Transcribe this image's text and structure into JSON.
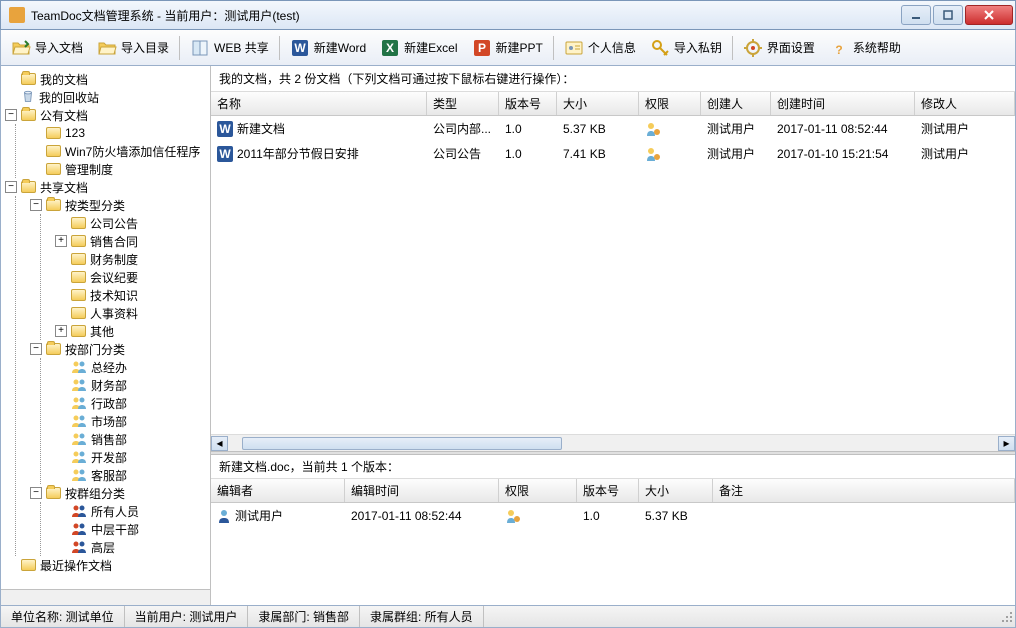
{
  "window": {
    "title": "TeamDoc文档管理系统 - 当前用户：测试用户(test)"
  },
  "toolbar": {
    "import_doc": "导入文档",
    "import_dir": "导入目录",
    "web_share": "WEB 共享",
    "new_word": "新建Word",
    "new_excel": "新建Excel",
    "new_ppt": "新建PPT",
    "personal_info": "个人信息",
    "import_key": "导入私钥",
    "ui_settings": "界面设置",
    "help": "系统帮助"
  },
  "tree": {
    "my_docs": "我的文档",
    "recycle": "我的回收站",
    "public_docs": "公有文档",
    "public_children": {
      "c1": "123",
      "c2": "Win7防火墙添加信任程序",
      "c3": "管理制度"
    },
    "shared_docs": "共享文档",
    "by_type": "按类型分类",
    "type_children": {
      "t1": "公司公告",
      "t2": "销售合同",
      "t3": "财务制度",
      "t4": "会议纪要",
      "t5": "技术知识",
      "t6": "人事资料",
      "t7": "其他"
    },
    "by_dept": "按部门分类",
    "dept_children": {
      "d1": "总经办",
      "d2": "财务部",
      "d3": "行政部",
      "d4": "市场部",
      "d5": "销售部",
      "d6": "开发部",
      "d7": "客服部"
    },
    "by_group": "按群组分类",
    "group_children": {
      "g1": "所有人员",
      "g2": "中层干部",
      "g3": "高层"
    },
    "recent": "最近操作文档"
  },
  "main": {
    "info_text": "我的文档，共 2 份文档（下列文档可通过按下鼠标右键进行操作）：",
    "columns": {
      "name": "名称",
      "type": "类型",
      "version": "版本号",
      "size": "大小",
      "perm": "权限",
      "creator": "创建人",
      "ctime": "创建时间",
      "modifier": "修改人"
    },
    "rows": [
      {
        "name": "新建文档",
        "type": "公司内部...",
        "version": "1.0",
        "size": "5.37 KB",
        "creator": "测试用户",
        "ctime": "2017-01-11 08:52:44",
        "modifier": "测试用户"
      },
      {
        "name": "2011年部分节假日安排",
        "type": "公司公告",
        "version": "1.0",
        "size": "7.41 KB",
        "creator": "测试用户",
        "ctime": "2017-01-10 15:21:54",
        "modifier": "测试用户"
      }
    ]
  },
  "version_panel": {
    "info_text": "新建文档.doc，当前共 1 个版本：",
    "columns": {
      "editor": "编辑者",
      "etime": "编辑时间",
      "perm": "权限",
      "version": "版本号",
      "size": "大小",
      "note": "备注"
    },
    "rows": [
      {
        "editor": "测试用户",
        "etime": "2017-01-11 08:52:44",
        "version": "1.0",
        "size": "5.37 KB",
        "note": ""
      }
    ]
  },
  "status": {
    "unit": "单位名称: 测试单位",
    "user": "当前用户: 测试用户",
    "dept": "隶属部门: 销售部",
    "group": "隶属群组: 所有人员"
  }
}
